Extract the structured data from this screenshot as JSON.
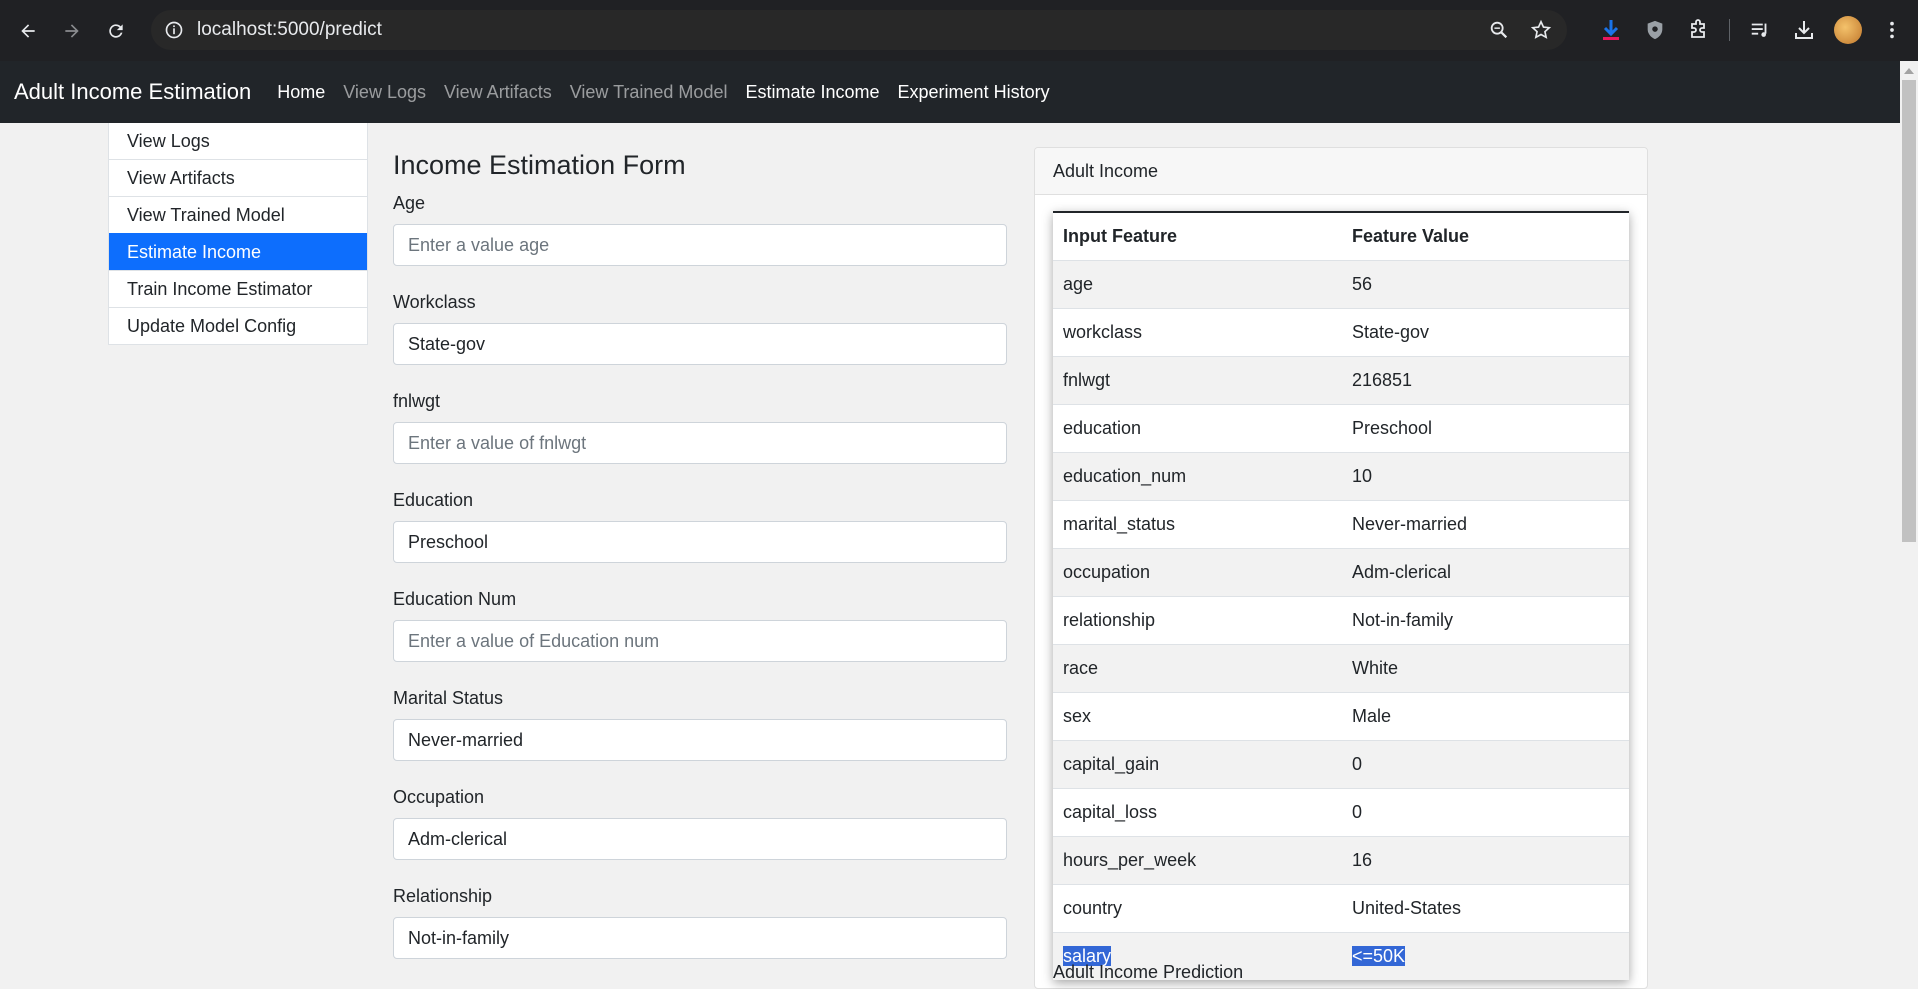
{
  "browser": {
    "url": "localhost:5000/predict"
  },
  "navbar": {
    "brand": "Adult Income Estimation",
    "links": [
      {
        "label": "Home",
        "active": true
      },
      {
        "label": "View Logs",
        "active": false
      },
      {
        "label": "View Artifacts",
        "active": false
      },
      {
        "label": "View Trained Model",
        "active": false
      },
      {
        "label": "Estimate Income",
        "active": true
      },
      {
        "label": "Experiment History",
        "active": true
      }
    ]
  },
  "sidebar": {
    "items": [
      {
        "label": "View Logs"
      },
      {
        "label": "View Artifacts"
      },
      {
        "label": "View Trained Model"
      },
      {
        "label": "Estimate Income",
        "active": true
      },
      {
        "label": "Train Income Estimator"
      },
      {
        "label": "Update Model Config"
      }
    ]
  },
  "form": {
    "title": "Income Estimation Form",
    "fields": [
      {
        "label": "Age",
        "value": "",
        "placeholder": "Enter a value age"
      },
      {
        "label": "Workclass",
        "value": "State-gov",
        "placeholder": ""
      },
      {
        "label": "fnlwgt",
        "value": "",
        "placeholder": "Enter a value of fnlwgt"
      },
      {
        "label": "Education",
        "value": "Preschool",
        "placeholder": ""
      },
      {
        "label": "Education Num",
        "value": "",
        "placeholder": "Enter a value of Education num"
      },
      {
        "label": "Marital Status",
        "value": "Never-married",
        "placeholder": ""
      },
      {
        "label": "Occupation",
        "value": "Adm-clerical",
        "placeholder": ""
      },
      {
        "label": "Relationship",
        "value": "Not-in-family",
        "placeholder": ""
      }
    ]
  },
  "card": {
    "header": "Adult Income",
    "columns": [
      "Input Feature",
      "Feature Value"
    ],
    "rows": [
      [
        "age",
        "56"
      ],
      [
        "workclass",
        "State-gov"
      ],
      [
        "fnlwgt",
        "216851"
      ],
      [
        "education",
        "Preschool"
      ],
      [
        "education_num",
        "10"
      ],
      [
        "marital_status",
        "Never-married"
      ],
      [
        "occupation",
        "Adm-clerical"
      ],
      [
        "relationship",
        "Not-in-family"
      ],
      [
        "race",
        "White"
      ],
      [
        "sex",
        "Male"
      ],
      [
        "capital_gain",
        "0"
      ],
      [
        "capital_loss",
        "0"
      ],
      [
        "hours_per_week",
        "16"
      ],
      [
        "country",
        "United-States"
      ],
      [
        "salary",
        "<=50K"
      ]
    ],
    "below_text": "Adult Income Prediction"
  },
  "colors": {
    "navbar_bg": "#212529",
    "active_blue": "#0d6efd",
    "selection_blue": "#3367d6"
  },
  "icons": [
    "back-arrow-icon",
    "forward-arrow-icon",
    "reload-icon",
    "site-info-icon",
    "zoom-icon",
    "bookmark-star-icon",
    "download-extension-icon",
    "shield-extension-icon",
    "extensions-puzzle-icon",
    "media-queue-icon",
    "downloads-icon",
    "profile-avatar",
    "menu-kebab-icon"
  ]
}
